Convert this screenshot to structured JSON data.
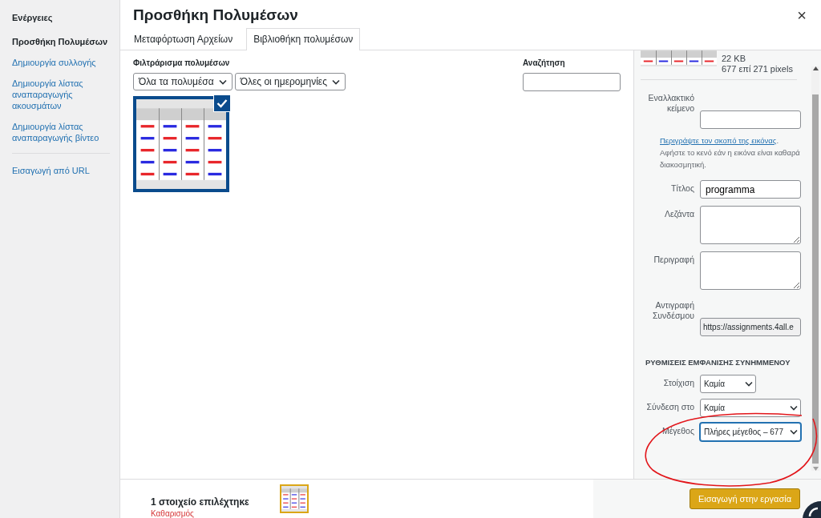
{
  "sidebar": {
    "heading": "Ενέργειες",
    "items": [
      {
        "label": "Προσθήκη Πολυμέσων",
        "selected": true
      },
      {
        "label": "Δημιουργία συλλογής",
        "selected": false
      },
      {
        "label": "Δημιουργία λίστας αναπαραγωγής ακουσμάτων",
        "selected": false
      },
      {
        "label": "Δημιουργία λίστας αναπαραγωγής βίντεο",
        "selected": false
      }
    ],
    "extra_items": [
      {
        "label": "Εισαγωγή από URL",
        "selected": false
      }
    ]
  },
  "modal": {
    "title": "Προσθήκη Πολυμέσων",
    "close": "×"
  },
  "tabs": [
    {
      "label": "Μεταφόρτωση Αρχείων",
      "selected": false
    },
    {
      "label": "Βιβλιοθήκη πολυμέσων",
      "selected": true
    }
  ],
  "filter": {
    "label": "Φιλτράρισμα πολυμέσων",
    "selects": [
      "Όλα τα πολυμέσα",
      "Όλες οι ημερομηνίες"
    ]
  },
  "search": {
    "label": "Αναζήτηση"
  },
  "attachments": [
    {
      "kind": "picture",
      "selected": true
    }
  ],
  "details": {
    "size": "22 KB",
    "dimensions": "677 επί 271 pixels",
    "fields": [
      {
        "kind": "input",
        "label": "Εναλλακτικό κείμενο"
      },
      {
        "kind": "help",
        "link": "Περιγράψτε τον σκοπό της εικόνας",
        "text": ". Αφήστε το κενό εάν η εικόνα είναι καθαρά διακοσμητική."
      },
      {
        "kind": "input",
        "label": "Τίτλος",
        "value": "programma"
      },
      {
        "kind": "textarea",
        "label": "Λεζάντα"
      },
      {
        "kind": "textarea",
        "label": "Περιγραφή"
      },
      {
        "kind": "readonly",
        "label": "Αντιγραφή Συνδέσμου",
        "value": "https://assignments.4all.e"
      }
    ],
    "display_heading": "ΡΥΘΜΙΣΕΙΣ ΕΜΦΑΝΙΣΗΣ ΣΥΝΗΜΜΕΝΟΥ",
    "display_fields": [
      {
        "kind": "select-narrow",
        "label": "Στοίχιση",
        "value": "Καμία",
        "focused": false
      },
      {
        "kind": "select",
        "label": "Σύνδεση στο",
        "value": "Καμία",
        "focused": false
      },
      {
        "kind": "select",
        "label": "Μέγεθος",
        "value": "Πλήρες μέγεθος – 677",
        "focused": true
      }
    ]
  },
  "footer": {
    "count": "1 στοιχείο επιλέχτηκε",
    "clear": "Καθαρισμός",
    "insert_button": "Εισαγωγή στην εργασία"
  },
  "annotations": [
    {
      "kind": "ellipse"
    }
  ]
}
